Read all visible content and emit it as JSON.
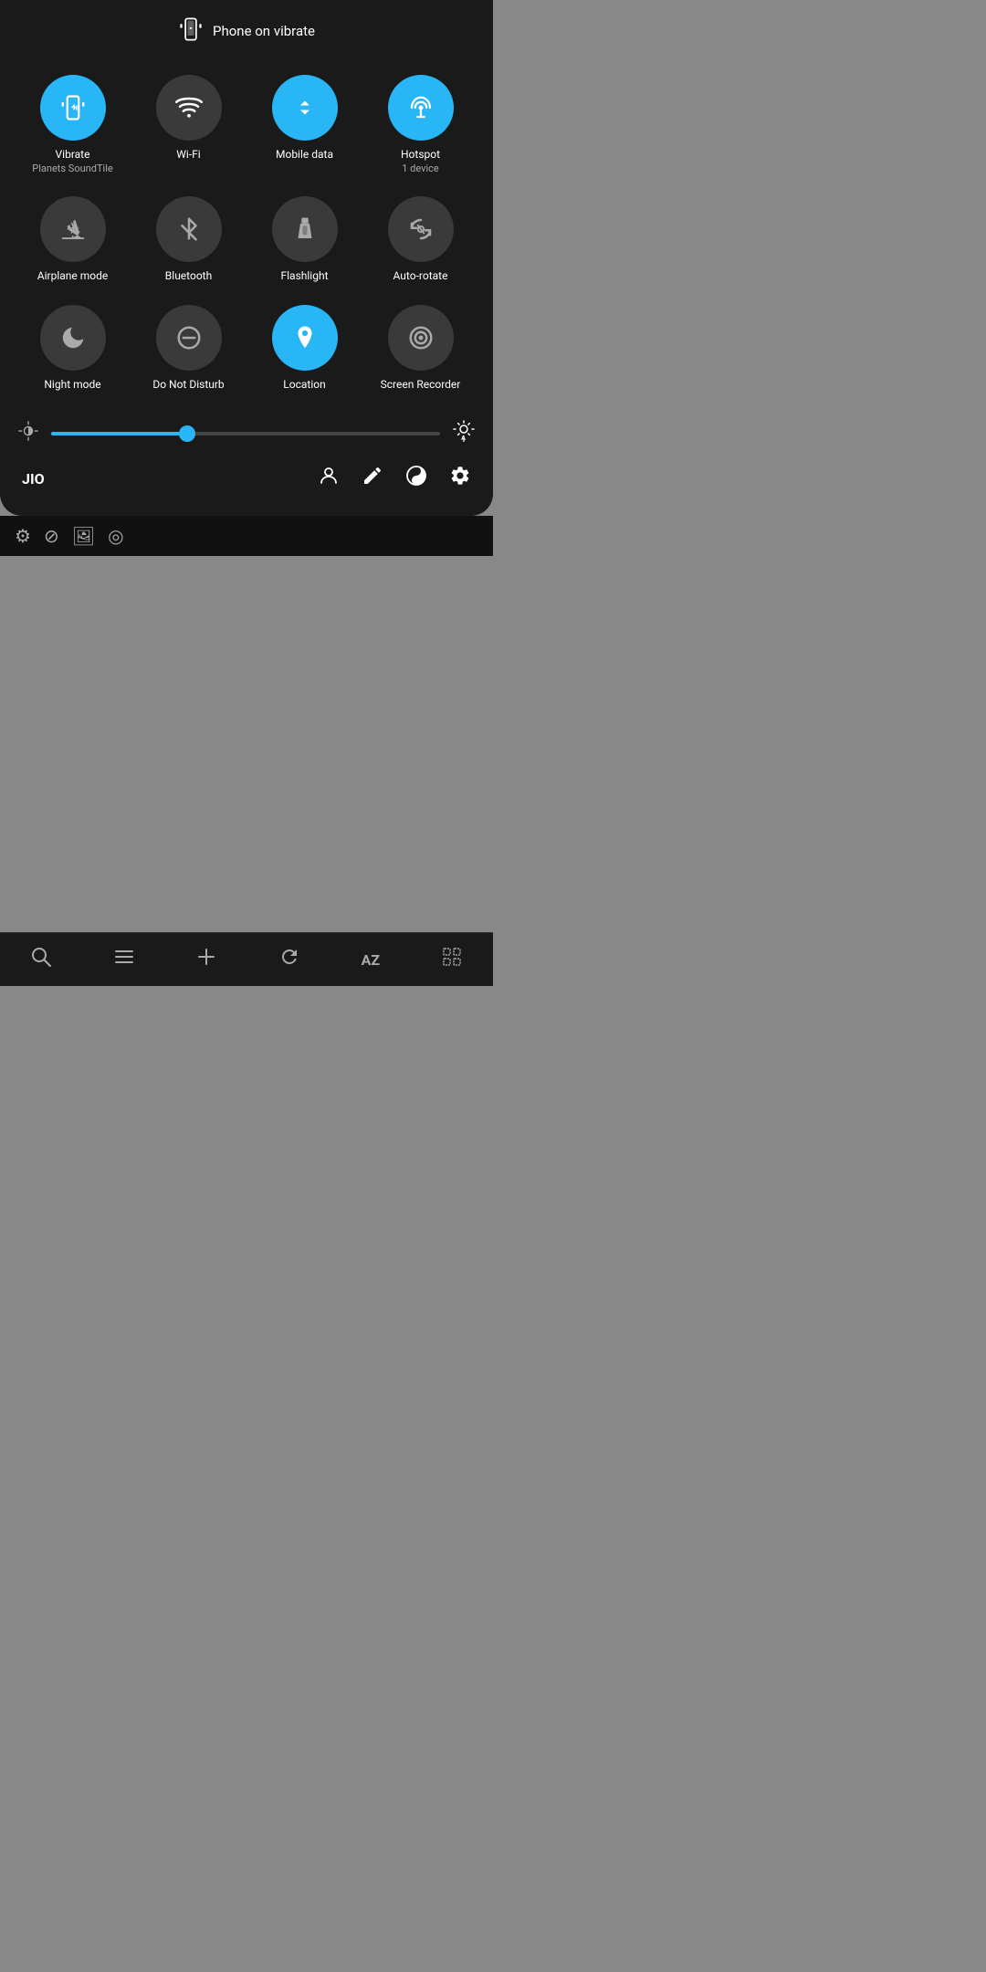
{
  "statusBar": {
    "vibrateText": "Phone on vibrate"
  },
  "tiles": [
    {
      "id": "vibrate",
      "label": "Vibrate",
      "sublabel": "Planets SoundTile",
      "active": true,
      "icon": "vibrate"
    },
    {
      "id": "wifi",
      "label": "Wi-Fi",
      "sublabel": "",
      "active": false,
      "icon": "wifi"
    },
    {
      "id": "mobile-data",
      "label": "Mobile data",
      "sublabel": "",
      "active": true,
      "icon": "mobile"
    },
    {
      "id": "hotspot",
      "label": "Hotspot",
      "sublabel": "1 device",
      "active": true,
      "icon": "hotspot"
    },
    {
      "id": "airplane",
      "label": "Airplane mode",
      "sublabel": "",
      "active": false,
      "icon": "airplane"
    },
    {
      "id": "bluetooth",
      "label": "Bluetooth",
      "sublabel": "",
      "active": false,
      "icon": "bluetooth"
    },
    {
      "id": "flashlight",
      "label": "Flashlight",
      "sublabel": "",
      "active": false,
      "icon": "flashlight"
    },
    {
      "id": "auto-rotate",
      "label": "Auto-rotate",
      "sublabel": "",
      "active": false,
      "icon": "autorotate"
    },
    {
      "id": "night-mode",
      "label": "Night mode",
      "sublabel": "",
      "active": false,
      "icon": "night"
    },
    {
      "id": "dnd",
      "label": "Do Not Disturb",
      "sublabel": "",
      "active": false,
      "icon": "dnd"
    },
    {
      "id": "location",
      "label": "Location",
      "sublabel": "",
      "active": true,
      "icon": "location"
    },
    {
      "id": "screen-recorder",
      "label": "Screen Recorder",
      "sublabel": "",
      "active": false,
      "icon": "recorder"
    }
  ],
  "brightness": {
    "value": 35,
    "percent": 35
  },
  "carrier": "JIO",
  "bottomIcons": [
    {
      "id": "user",
      "icon": "user"
    },
    {
      "id": "edit",
      "icon": "edit"
    },
    {
      "id": "yin-yang",
      "icon": "yinyang"
    },
    {
      "id": "settings",
      "icon": "settings"
    }
  ],
  "notificationBarIcons": [
    {
      "id": "settings-notif",
      "icon": "⚙"
    },
    {
      "id": "do-not-disturb-notif",
      "icon": "⊘"
    },
    {
      "id": "photo-notif",
      "icon": "🖼"
    },
    {
      "id": "hotspot-notif",
      "icon": "◎"
    }
  ],
  "taskbarIcons": [
    {
      "id": "search",
      "symbol": "🔍"
    },
    {
      "id": "list",
      "symbol": "☰"
    },
    {
      "id": "add",
      "symbol": "+"
    },
    {
      "id": "refresh",
      "symbol": "↻"
    },
    {
      "id": "az",
      "symbol": "AZ"
    },
    {
      "id": "grid",
      "symbol": "⊞"
    }
  ]
}
